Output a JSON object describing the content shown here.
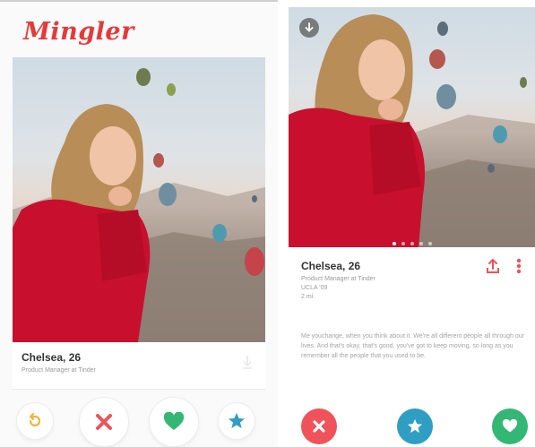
{
  "app": {
    "logo_text": "Mingler",
    "brand_color": "#e53a3a"
  },
  "left_card": {
    "name_age": "Chelsea, 26",
    "job": "Product Manager at Tinder"
  },
  "right_card": {
    "name_age": "Chelsea, 26",
    "job": "Product Manager at Tinder",
    "school": "UCLA '09",
    "distance": "2 mi",
    "bio": "Me youchange, when you think about it. We're all different people all through our lives. And that's okay, that's good, you've got to keep moving, so long as you remember all the people that you used to be.",
    "photo_count": 5,
    "active_photo_index": 0
  },
  "icons": {
    "rewind": "rewind-icon",
    "nope": "x-icon",
    "like": "heart-icon",
    "superlike": "star-icon",
    "share": "share-icon",
    "more": "more-vertical-icon",
    "info": "info-down-arrow-icon"
  },
  "colors": {
    "nope": "#f0525a",
    "superlike": "#2f9ec2",
    "like": "#33b774",
    "rewind": "#f3b53a"
  }
}
